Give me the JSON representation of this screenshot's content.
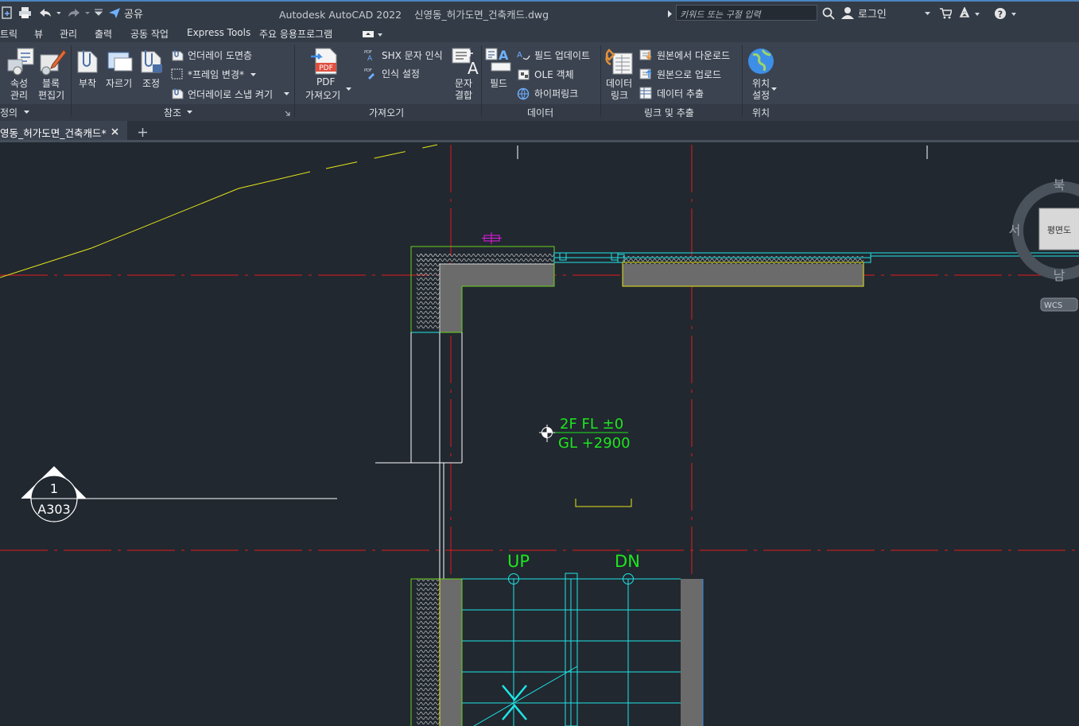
{
  "titlebar": {
    "app_title": "Autodesk AutoCAD 2022",
    "file_title": "신영동_허가도면_건축캐드.dwg",
    "share_label": "공유",
    "search_placeholder": "키워드 또는 구절 입력",
    "login_label": "로그인"
  },
  "menubar": {
    "items": [
      "트릭",
      "뷰",
      "관리",
      "출력",
      "공동 작업",
      "Express Tools",
      "주요 응용프로그램"
    ]
  },
  "ribbon": {
    "block_panel": {
      "attr_manage_line1": "속성",
      "attr_manage_line2": "관리",
      "block_editor_line1": "블록",
      "block_editor_line2": "편집기",
      "footer": "정의"
    },
    "reference_panel": {
      "attach": "부착",
      "clip": "자르기",
      "adjust": "조정",
      "underlay_layers": "언더레이 도면층",
      "frames_vary": "*프레임 변경*",
      "snap_underlay": "언더레이로 스냅 켜기",
      "footer": "참조"
    },
    "import_panel": {
      "pdf_import_line1": "PDF",
      "pdf_import_line2": "가져오기",
      "pdf_icon_text": "PDF",
      "shx_recognize": "SHX 문자 인식",
      "recognize_settings": "인식 설정",
      "combine_text_line1": "문자",
      "combine_text_line2": "결합",
      "footer": "가져오기"
    },
    "data_panel": {
      "field": "필드",
      "update_fields": "필드 업데이트",
      "ole_object": "OLE 객체",
      "hyperlink": "하이퍼링크",
      "footer": "데이터"
    },
    "link_panel": {
      "data_link_line1": "데이터",
      "data_link_line2": "링크",
      "download_source": "원본에서 다운로드",
      "upload_source": "원본으로 업로드",
      "extract_data": "데이터 추출",
      "footer": "링크 및 추출"
    },
    "location_panel": {
      "set_location_line1": "위치",
      "set_location_line2": "설정",
      "footer": "위치"
    }
  },
  "tabs": {
    "active_tab": "영동_허가도면_건축캐드*"
  },
  "drawing": {
    "level_fl": "2F FL ±0",
    "level_gl": "GL +2900",
    "stair_up": "UP",
    "stair_dn": "DN",
    "section_number": "1",
    "section_sheet": "A303"
  },
  "viewcube": {
    "north": "북",
    "west": "서",
    "south": "남",
    "face": "평면도",
    "wcs": "WCS"
  },
  "colors": {
    "background": "#212830",
    "ribbon": "#3b4350",
    "grid_line": "#e31a1a",
    "wall_outline": "#e6e619",
    "cyan_line": "#1ee6e6",
    "text_green": "#1ee61e"
  }
}
